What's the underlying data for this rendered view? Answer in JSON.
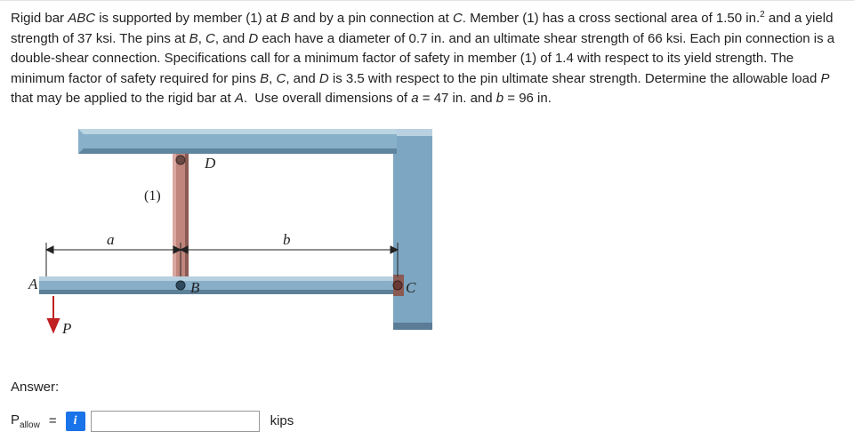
{
  "problem": {
    "html": "Rigid bar <em>ABC</em> is supported by member (1) at <em>B</em> and by a pin connection at <em>C</em>. Member (1) has a cross sectional area of 1.50 in.<sup>2</sup> and a yield strength of 37 ksi. The pins at <em>B</em>, <em>C</em>, and <em>D</em> each have a diameter of 0.7 in. and an ultimate shear strength of 66 ksi. Each pin connection is a double-shear connection. Specifications call for a minimum factor of safety in member (1) of 1.4 with respect to its yield strength. The minimum factor of safety required for pins <em>B</em>, <em>C</em>, and <em>D</em> is 3.5 with respect to the pin ultimate shear strength. Determine the allowable load <em>P</em> that may be applied to the rigid bar at <em>A</em>.&nbsp; Use overall dimensions of <em>a</em> = 47 in. and <em>b</em> = 96 in."
  },
  "figure": {
    "labels": {
      "A": "A",
      "B": "B",
      "C": "C",
      "D": "D",
      "P": "P",
      "a": "a",
      "b": "b",
      "member1": "(1)"
    }
  },
  "answer": {
    "heading": "Answer:",
    "variable_html": "P<sub>allow</sub>",
    "equals": "=",
    "info_icon": "i",
    "value": "",
    "unit": "kips"
  }
}
